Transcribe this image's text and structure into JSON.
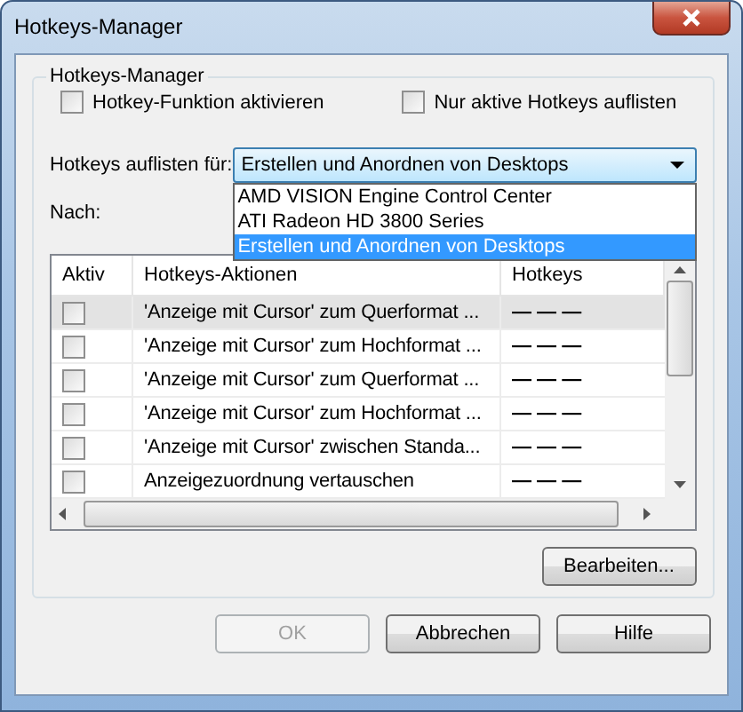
{
  "window": {
    "title": "Hotkeys-Manager"
  },
  "group": {
    "title": "Hotkeys-Manager"
  },
  "options": [
    {
      "label": "Hotkey-Funktion aktivieren",
      "checked": false
    },
    {
      "label": "Nur aktive Hotkeys auflisten",
      "checked": false
    }
  ],
  "list_for": {
    "label": "Hotkeys auflisten für:",
    "value": "Erstellen und Anordnen von Desktops",
    "expanded": true,
    "options": [
      {
        "label": "AMD VISION Engine Control Center",
        "selected": false
      },
      {
        "label": "ATI Radeon HD 3800 Series",
        "selected": false
      },
      {
        "label": "Erstellen und Anordnen von Desktops",
        "selected": true
      }
    ]
  },
  "nach": {
    "label": "Nach:"
  },
  "table": {
    "columns": [
      "Aktiv",
      "Hotkeys-Aktionen",
      "Hotkeys"
    ],
    "rows": [
      {
        "active": false,
        "action": "'Anzeige mit Cursor' zum Querformat ...",
        "hotkey": "— — —",
        "selected": true
      },
      {
        "active": false,
        "action": "'Anzeige mit Cursor' zum Hochformat ...",
        "hotkey": "— — —",
        "selected": false
      },
      {
        "active": false,
        "action": "'Anzeige mit Cursor' zum Querformat ...",
        "hotkey": "— — —",
        "selected": false
      },
      {
        "active": false,
        "action": "'Anzeige mit Cursor' zum Hochformat ...",
        "hotkey": "— — —",
        "selected": false
      },
      {
        "active": false,
        "action": "'Anzeige mit Cursor' zwischen Standa...",
        "hotkey": "— — —",
        "selected": false
      },
      {
        "active": false,
        "action": "Anzeigezuordnung vertauschen",
        "hotkey": "— — —",
        "selected": false
      }
    ]
  },
  "edit_button": {
    "label": "Bearbeiten...",
    "disabled": false
  },
  "buttons": [
    {
      "label": "OK",
      "disabled": true
    },
    {
      "label": "Abbrechen",
      "disabled": false
    },
    {
      "label": "Hilfe",
      "disabled": false
    }
  ]
}
